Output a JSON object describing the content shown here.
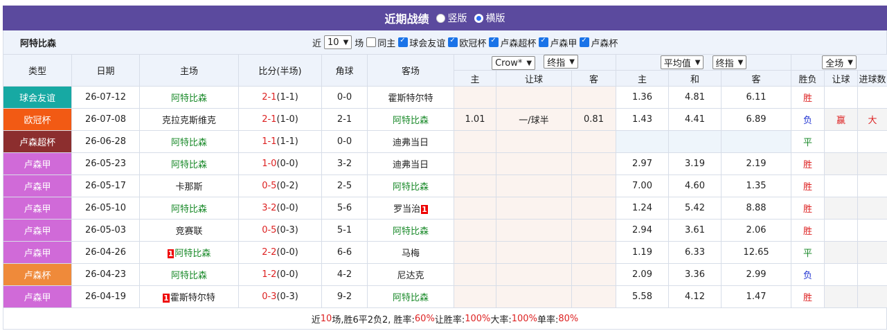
{
  "title": "近期战绩",
  "view_options": [
    "竖版",
    "横版"
  ],
  "team_name": "阿特比森",
  "filter": {
    "prefix": "近",
    "count": "10",
    "suffix": "场",
    "same_home": "同主",
    "competitions": [
      "球会友谊",
      "欧冠杯",
      "卢森超杯",
      "卢森甲",
      "卢森杯"
    ]
  },
  "headers": {
    "type": "类型",
    "date": "日期",
    "home": "主场",
    "score": "比分(半场)",
    "corner": "角球",
    "away": "客场",
    "handicap_company": "Crow*",
    "handicap_mode": "终指",
    "avg_mode": "平均值",
    "avg_type": "终指",
    "scope": "全场",
    "sub": {
      "h_home": "主",
      "h_line": "让球",
      "h_away": "客",
      "a_home": "主",
      "a_draw": "和",
      "a_away": "客",
      "result": "胜负",
      "ah": "让球",
      "ou": "进球数"
    }
  },
  "colors": {
    "球会友谊": "#17a9a3",
    "欧冠杯": "#f25a14",
    "卢森超杯": "#8c2e2e",
    "卢森甲": "#d06ad8",
    "卢森杯": "#ef8a3a"
  },
  "rows": [
    {
      "type": "球会友谊",
      "date": "26-07-12",
      "home": "阿特比森",
      "home_card": "",
      "home_hl": true,
      "ft": "2-1",
      "ht": "(1-1)",
      "corner": "0-0",
      "away": "霍斯特尔特",
      "away_card": "",
      "away_hl": false,
      "oh": "",
      "ol": "",
      "oa": "",
      "ah": "1.36",
      "ad": "4.81",
      "aa": "6.11",
      "res": "胜",
      "ah_res": "",
      "ou_res": ""
    },
    {
      "type": "欧冠杯",
      "date": "26-07-08",
      "home": "克拉克斯维克",
      "home_card": "",
      "home_hl": false,
      "ft": "2-1",
      "ht": "(1-0)",
      "corner": "2-1",
      "away": "阿特比森",
      "away_card": "",
      "away_hl": true,
      "oh": "1.01",
      "ol": "一/球半",
      "oa": "0.81",
      "ah": "1.43",
      "ad": "4.41",
      "aa": "6.89",
      "res": "负",
      "ah_res": "赢",
      "ou_res": "大"
    },
    {
      "type": "卢森超杯",
      "date": "26-06-28",
      "home": "阿特比森",
      "home_card": "",
      "home_hl": true,
      "ft": "1-1",
      "ht": "(1-1)",
      "corner": "0-0",
      "away": "迪弗当日",
      "away_card": "",
      "away_hl": false,
      "oh": "",
      "ol": "",
      "oa": "",
      "ah": "",
      "ad": "",
      "aa": "",
      "res": "平",
      "ah_res": "",
      "ou_res": ""
    },
    {
      "type": "卢森甲",
      "date": "26-05-23",
      "home": "阿特比森",
      "home_card": "",
      "home_hl": true,
      "ft": "1-0",
      "ht": "(0-0)",
      "corner": "3-2",
      "away": "迪弗当日",
      "away_card": "",
      "away_hl": false,
      "oh": "",
      "ol": "",
      "oa": "",
      "ah": "2.97",
      "ad": "3.19",
      "aa": "2.19",
      "res": "胜",
      "ah_res": "",
      "ou_res": ""
    },
    {
      "type": "卢森甲",
      "date": "26-05-17",
      "home": "卡那斯",
      "home_card": "",
      "home_hl": false,
      "ft": "0-5",
      "ht": "(0-2)",
      "corner": "2-5",
      "away": "阿特比森",
      "away_card": "",
      "away_hl": true,
      "oh": "",
      "ol": "",
      "oa": "",
      "ah": "7.00",
      "ad": "4.60",
      "aa": "1.35",
      "res": "胜",
      "ah_res": "",
      "ou_res": ""
    },
    {
      "type": "卢森甲",
      "date": "26-05-10",
      "home": "阿特比森",
      "home_card": "",
      "home_hl": true,
      "ft": "3-2",
      "ht": "(0-0)",
      "corner": "5-6",
      "away": "罗当治",
      "away_card": "1",
      "away_hl": false,
      "oh": "",
      "ol": "",
      "oa": "",
      "ah": "1.24",
      "ad": "5.42",
      "aa": "8.88",
      "res": "胜",
      "ah_res": "",
      "ou_res": ""
    },
    {
      "type": "卢森甲",
      "date": "26-05-03",
      "home": "竞赛联",
      "home_card": "",
      "home_hl": false,
      "ft": "0-5",
      "ht": "(0-3)",
      "corner": "5-1",
      "away": "阿特比森",
      "away_card": "",
      "away_hl": true,
      "oh": "",
      "ol": "",
      "oa": "",
      "ah": "2.94",
      "ad": "3.61",
      "aa": "2.06",
      "res": "胜",
      "ah_res": "",
      "ou_res": ""
    },
    {
      "type": "卢森甲",
      "date": "26-04-26",
      "home": "阿特比森",
      "home_card": "1",
      "home_hl": true,
      "ft": "2-2",
      "ht": "(0-0)",
      "corner": "6-6",
      "away": "马梅",
      "away_card": "",
      "away_hl": false,
      "oh": "",
      "ol": "",
      "oa": "",
      "ah": "1.19",
      "ad": "6.33",
      "aa": "12.65",
      "res": "平",
      "ah_res": "",
      "ou_res": ""
    },
    {
      "type": "卢森杯",
      "date": "26-04-23",
      "home": "阿特比森",
      "home_card": "",
      "home_hl": true,
      "ft": "1-2",
      "ht": "(0-0)",
      "corner": "4-2",
      "away": "尼达克",
      "away_card": "",
      "away_hl": false,
      "oh": "",
      "ol": "",
      "oa": "",
      "ah": "2.09",
      "ad": "3.36",
      "aa": "2.99",
      "res": "负",
      "ah_res": "",
      "ou_res": ""
    },
    {
      "type": "卢森甲",
      "date": "26-04-19",
      "home": "霍斯特尔特",
      "home_card": "1",
      "home_hl": false,
      "ft": "0-3",
      "ht": "(0-3)",
      "corner": "9-2",
      "away": "阿特比森",
      "away_card": "",
      "away_hl": true,
      "oh": "",
      "ol": "",
      "oa": "",
      "ah": "5.58",
      "ad": "4.12",
      "aa": "1.47",
      "res": "胜",
      "ah_res": "",
      "ou_res": ""
    }
  ],
  "summary": {
    "p1": "近",
    "games": "10",
    "p2": "场,胜6平2负2, 胜率:",
    "win_rate": "60%",
    "p3": " 让胜率:",
    "ah_rate": "100%",
    "p4": " 大率:",
    "over_rate": "100%",
    "p5": " 单率:",
    "odd_rate": "80%"
  }
}
